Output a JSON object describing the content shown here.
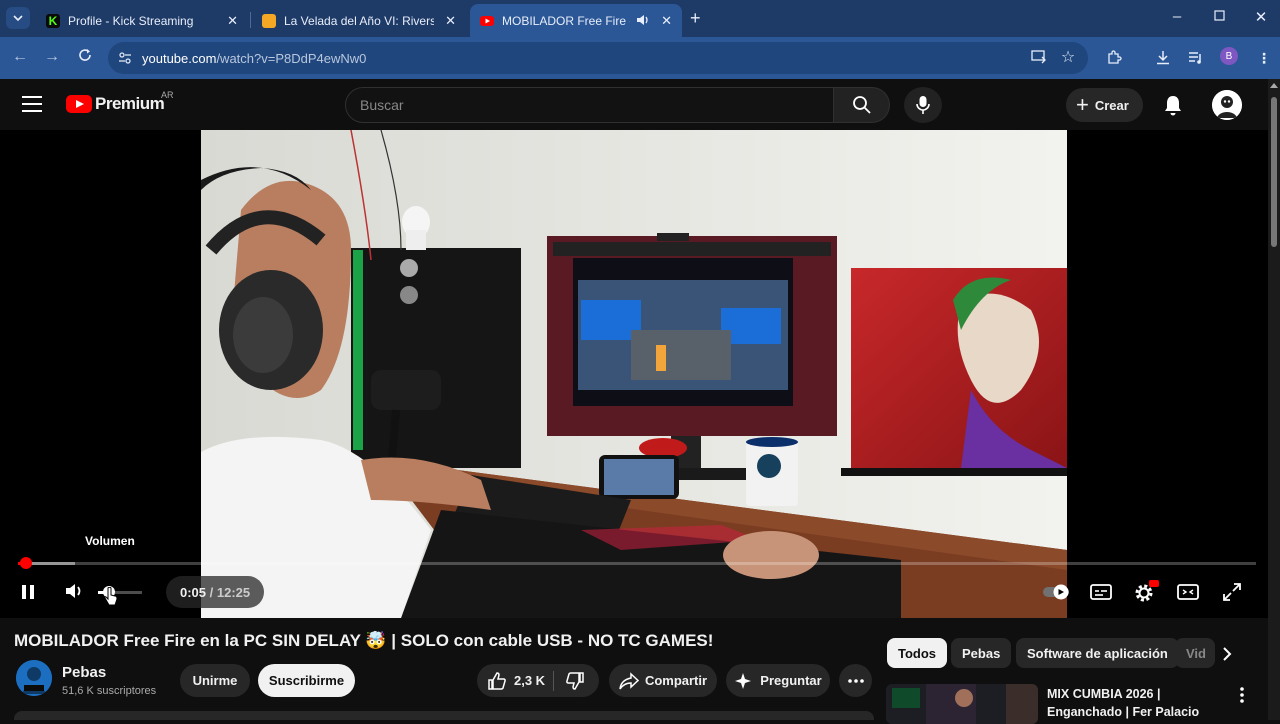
{
  "browser": {
    "tabs": [
      {
        "title": "Profile - Kick Streaming",
        "favicon_color": "#53fc18"
      },
      {
        "title": "La Velada del Año VI: Rivers vs",
        "favicon_color": "#f4a823"
      },
      {
        "title": "MOBILADOR Free Fire en la",
        "favicon_color": "#ff0000",
        "active": true
      }
    ],
    "url_host": "youtube.com",
    "url_path": "/watch?v=P8DdP4ewNw0",
    "profile_initial": "B"
  },
  "header": {
    "logo_text": "Premium",
    "country": "AR",
    "search_placeholder": "Buscar",
    "create_label": "Crear"
  },
  "player": {
    "tooltip": "Volumen",
    "time_current": "0:05",
    "time_separator": " / ",
    "time_total": "12:25",
    "progress_played_fraction": 0.0067,
    "progress_loaded_fraction": 0.046,
    "volume_fraction": 0.25
  },
  "video": {
    "title": "MOBILADOR Free Fire en la PC SIN DELAY 🤯 | SOLO con cable USB - NO TC GAMES!",
    "channel_name": "Pebas",
    "subscribers": "51,6 K suscriptores",
    "join_label": "Unirme",
    "subscribe_label": "Suscribirme",
    "likes": "2,3 K",
    "share_label": "Compartir",
    "ask_label": "Preguntar"
  },
  "chips": [
    "Todos",
    "Pebas",
    "Software de aplicación",
    "Vid"
  ],
  "recommendation": {
    "title": "MIX CUMBIA 2026 | Enganchado | Fer Palacio"
  },
  "colors": {
    "accent": "#ff0000",
    "chrome_tabbar": "#1e3a66",
    "chrome_toolbar": "#2b5796",
    "background": "#0f0f0f"
  }
}
